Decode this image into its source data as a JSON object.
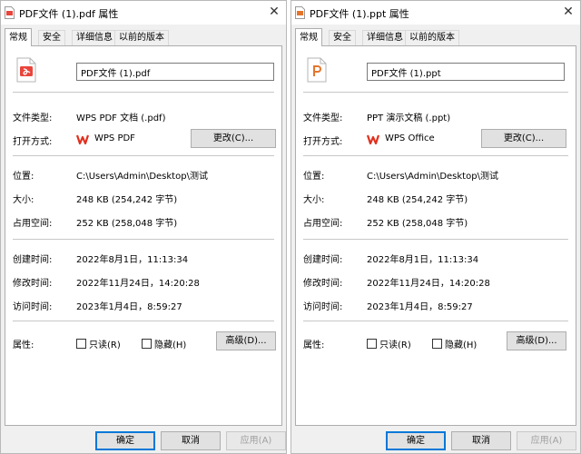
{
  "left": {
    "title": "PDF文件 (1).pdf 属性",
    "tabs": [
      "常规",
      "安全",
      "详细信息",
      "以前的版本"
    ],
    "filename": "PDF文件 (1).pdf",
    "file_type_label": "文件类型:",
    "file_type": "WPS PDF 文档 (.pdf)",
    "open_with_label": "打开方式:",
    "open_with_app": "WPS PDF",
    "change_button": "更改(C)...",
    "location_label": "位置:",
    "location": "C:\\Users\\Admin\\Desktop\\测试",
    "size_label": "大小:",
    "size": "248 KB (254,242 字节)",
    "size_on_disk_label": "占用空间:",
    "size_on_disk": "252 KB (258,048 字节)",
    "created_label": "创建时间:",
    "created": "2022年8月1日，11:13:34",
    "modified_label": "修改时间:",
    "modified": "2022年11月24日，14:20:28",
    "accessed_label": "访问时间:",
    "accessed": "2023年1月4日，8:59:27",
    "attributes_label": "属性:",
    "readonly_label": "只读(R)",
    "hidden_label": "隐藏(H)",
    "advanced_button": "高级(D)...",
    "ok_button": "确定",
    "cancel_button": "取消",
    "apply_button": "应用(A)"
  },
  "right": {
    "title": "PDF文件 (1).ppt 属性",
    "tabs": [
      "常规",
      "安全",
      "详细信息",
      "以前的版本"
    ],
    "filename": "PDF文件 (1).ppt",
    "file_type_label": "文件类型:",
    "file_type": "PPT 演示文稿 (.ppt)",
    "open_with_label": "打开方式:",
    "open_with_app": "WPS Office",
    "change_button": "更改(C)...",
    "location_label": "位置:",
    "location": "C:\\Users\\Admin\\Desktop\\测试",
    "size_label": "大小:",
    "size": "248 KB (254,242 字节)",
    "size_on_disk_label": "占用空间:",
    "size_on_disk": "252 KB (258,048 字节)",
    "created_label": "创建时间:",
    "created": "2022年8月1日，11:13:34",
    "modified_label": "修改时间:",
    "modified": "2022年11月24日，14:20:28",
    "accessed_label": "访问时间:",
    "accessed": "2023年1月4日，8:59:27",
    "attributes_label": "属性:",
    "readonly_label": "只读(R)",
    "hidden_label": "隐藏(H)",
    "advanced_button": "高级(D)...",
    "ok_button": "确定",
    "cancel_button": "取消",
    "apply_button": "应用(A)"
  },
  "close_glyph": "✕",
  "colors": {
    "pdf_red": "#e8453c",
    "ppt_orange": "#e5742b",
    "wps_red": "#e0301e",
    "accent_blue": "#0078d7"
  },
  "icons": {
    "pdf_file": "pdf-file-icon",
    "ppt_file": "ppt-file-icon",
    "wps": "wps-logo-icon",
    "close": "close-icon"
  }
}
